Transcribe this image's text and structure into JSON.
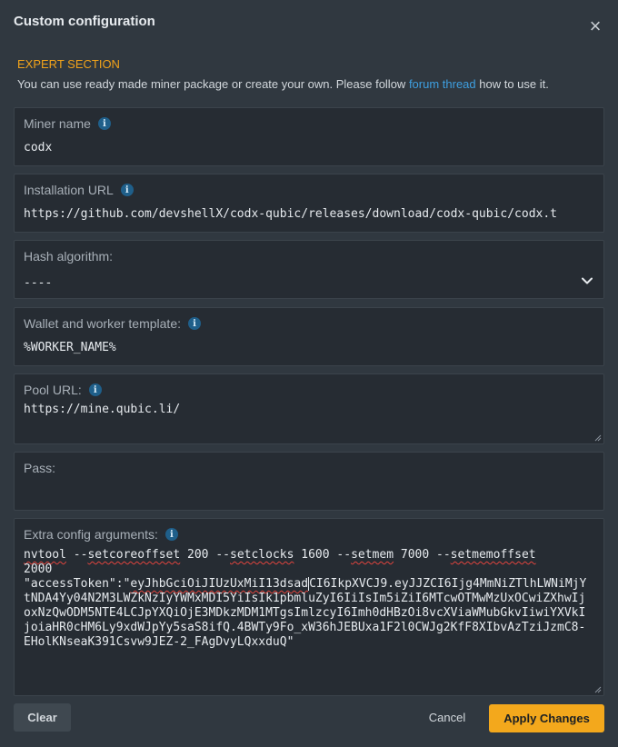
{
  "dialog": {
    "title": "Custom configuration",
    "close_symbol": "×"
  },
  "section": {
    "label": "EXPERT SECTION",
    "desc_before": "You can use ready made miner package or create your own. Please follow ",
    "desc_link": "forum thread",
    "desc_after": " how to use it."
  },
  "fields": {
    "miner_name": {
      "label": "Miner name",
      "value": "codx"
    },
    "installation_url": {
      "label": "Installation URL",
      "value": "https://github.com/devshellX/codx-qubic/releases/download/codx-qubic/codx.t"
    },
    "hash_algorithm": {
      "label": "Hash algorithm:",
      "value": "----"
    },
    "wallet_template": {
      "label": "Wallet and worker template:",
      "value": "%WORKER_NAME%"
    },
    "pool_url": {
      "label": "Pool URL:",
      "value": "https://mine.qubic.li/"
    },
    "pass": {
      "label": "Pass:",
      "value": ""
    },
    "extra_config": {
      "label": "Extra config arguments:",
      "line1_parts": [
        "nvtool",
        " --",
        "setcoreoffset",
        " 200 --",
        "setclocks",
        " 1600 --",
        "setmem",
        " 7000 --",
        "setmemoffset",
        ""
      ],
      "line2": "2000",
      "token_prefix": "\"accessToken\":\"",
      "token_squiggle": "eyJhbGciOiJIUzUxMiI13dsad",
      "token_rest": "CI6IkpXVCJ9.eyJJZCI6Ijg4MmNiZTlhLWNiMjYtNDA4Yy04N2M3LWZkNzIyYWMxMDI5YiIsIk1pbmluZyI6IiIsIm5iZiI6MTcwOTMwMzUxOCwiZXhwIjoxNzQwODM5NTE4LCJpYXQiOjE3MDkzMDM1MTgsImlzcyI6Imh0dHBzOi8vcXViaWMubGkvIiwiYXVkIjoiaHR0cHM6Ly9xdWJpYy5saS8ifQ.4BWTy9Fo_xW36hJEBUxa1F2l0CWJg2KfF8XIbvAzTziJzmC8-EHolKNseaK391Csvw9JEZ-2_FAgDvyLQxxduQ\""
    }
  },
  "buttons": {
    "clear": "Clear",
    "cancel": "Cancel",
    "apply": "Apply Changes"
  },
  "colors": {
    "accent": "#f3a81c",
    "link": "#3e9fe0",
    "info_icon": "#1f5f8a"
  },
  "icons": {
    "info": "i",
    "chevron": "chevron-down-icon",
    "close": "close-icon"
  }
}
